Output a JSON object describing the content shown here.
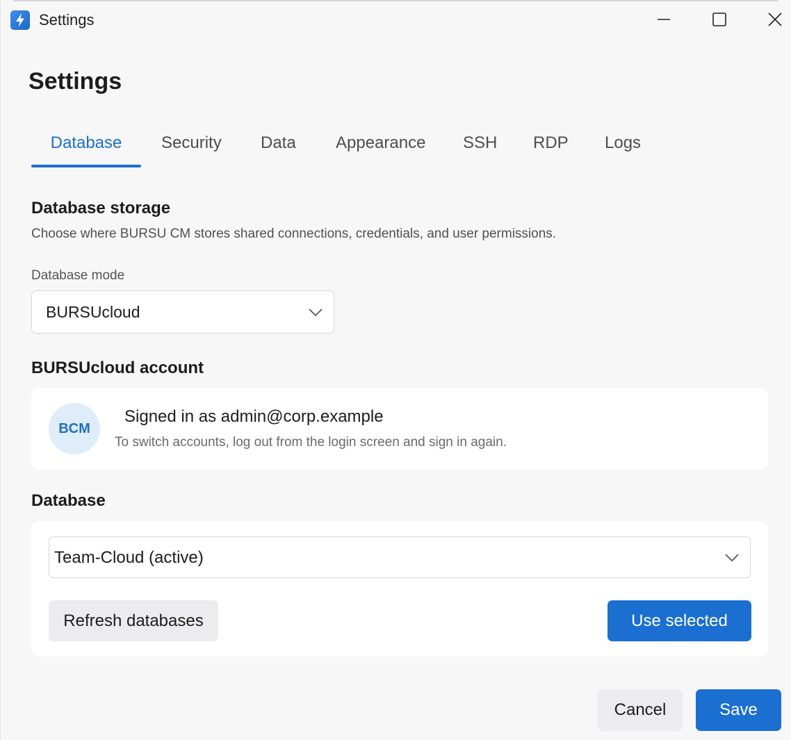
{
  "window": {
    "title": "Settings",
    "controls": {
      "minimize": "minimize-icon",
      "maximize": "maximize-icon",
      "close": "close-icon"
    }
  },
  "page": {
    "title": "Settings"
  },
  "tabs": [
    {
      "label": "Database",
      "active": true
    },
    {
      "label": "Security",
      "active": false
    },
    {
      "label": "Data",
      "active": false
    },
    {
      "label": "Appearance",
      "active": false
    },
    {
      "label": "SSH",
      "active": false
    },
    {
      "label": "RDP",
      "active": false
    },
    {
      "label": "Logs",
      "active": false
    }
  ],
  "storage": {
    "title": "Database storage",
    "description": "Choose where BURSU CM stores shared connections, credentials, and user permissions.",
    "mode_label": "Database mode",
    "mode_value": "BURSUcloud"
  },
  "account": {
    "title": "BURSUcloud account",
    "avatar_initials": "BCM",
    "signed_in": "Signed in as admin@corp.example",
    "hint": "To switch accounts, log out from the login screen and sign in again."
  },
  "database": {
    "title": "Database",
    "selected": "Team-Cloud (active)",
    "refresh_label": "Refresh databases",
    "use_selected_label": "Use selected"
  },
  "footer": {
    "cancel_label": "Cancel",
    "save_label": "Save"
  },
  "colors": {
    "accent": "#1b6fd0",
    "background": "#f7f7f8",
    "card": "#ffffff",
    "avatar_bg": "#deedf9"
  }
}
